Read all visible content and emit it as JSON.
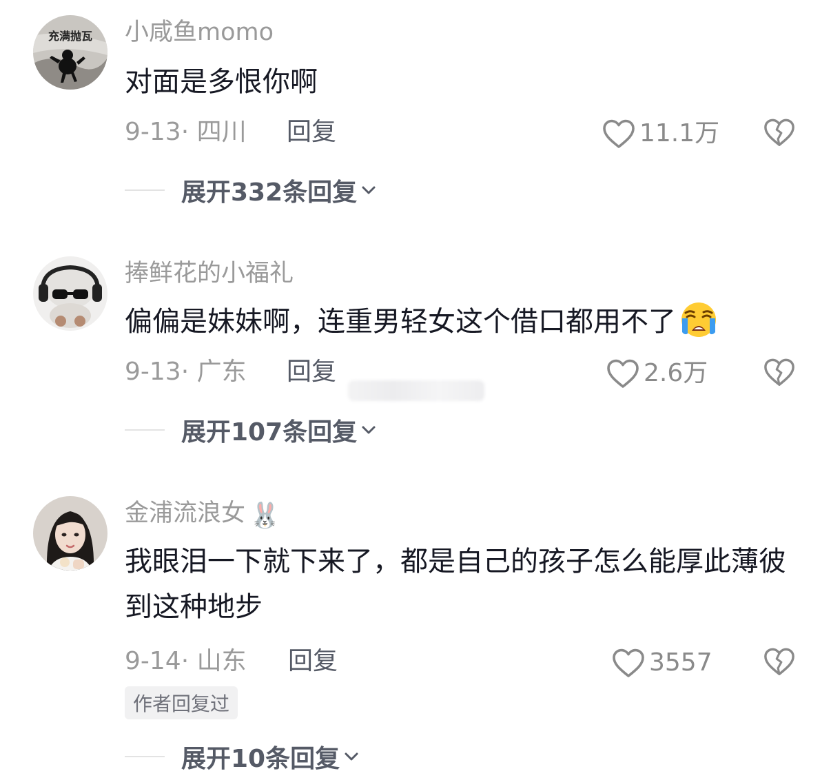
{
  "comments": [
    {
      "username": "小咸鱼momo",
      "avatar_text": "充满抛瓦",
      "text": "对面是多恨你啊",
      "date_location": "9-13· 四川",
      "reply_label": "回复",
      "likes": "11.1万",
      "expand_label": "展开332条回复"
    },
    {
      "username": "捧鲜花的小福礼",
      "text": "偏偏是妹妹啊，连重男轻女这个借口都用不了",
      "emoji": "loudly-crying-face",
      "date_location": "9-13· 广东",
      "reply_label": "回复",
      "likes": "2.6万",
      "expand_label": "展开107条回复"
    },
    {
      "username": "金浦流浪女",
      "username_emoji": "🐰",
      "text": "我眼泪一下就下来了，都是自己的孩子怎么能厚此薄彼到这种地步",
      "date_location": "9-14· 山东",
      "reply_label": "回复",
      "likes": "3557",
      "author_tag": "作者回复过",
      "expand_label": "展开10条回复"
    }
  ],
  "icons": {
    "like": "heart-outline-icon",
    "dislike": "broken-heart-icon",
    "expand": "chevron-down-icon"
  },
  "colors": {
    "text_primary": "#161823",
    "text_secondary": "#9a9a9a",
    "action_text": "#555a66",
    "tag_bg": "#f1f1f2"
  }
}
